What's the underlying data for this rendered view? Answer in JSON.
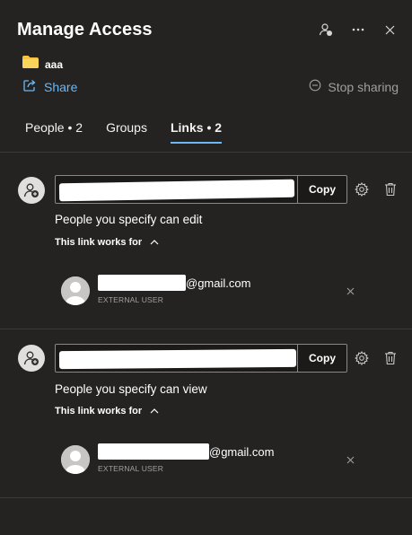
{
  "header": {
    "title": "Manage Access",
    "icons": [
      "manage-permissions-icon",
      "more-options-icon",
      "close-icon"
    ]
  },
  "item": {
    "icon": "folder-icon",
    "name": "aaa"
  },
  "actions": {
    "share_label": "Share",
    "stop_sharing_label": "Stop sharing"
  },
  "tabs": [
    {
      "label": "People • 2",
      "active": false
    },
    {
      "label": "Groups",
      "active": false
    },
    {
      "label": "Links • 2",
      "active": true
    }
  ],
  "links": [
    {
      "copy_label": "Copy",
      "permission": "People you specify can edit",
      "works_for_label": "This link works for",
      "user": {
        "email_suffix": "@gmail.com",
        "role": "EXTERNAL USER"
      }
    },
    {
      "copy_label": "Copy",
      "permission": "People you specify can view",
      "works_for_label": "This link works for",
      "user": {
        "email_suffix": "@gmail.com",
        "role": "EXTERNAL USER"
      }
    }
  ],
  "colors": {
    "background": "#242322",
    "accent": "#6cb8f6",
    "muted_text": "#a19f9d",
    "folder": "#f8c23a"
  }
}
